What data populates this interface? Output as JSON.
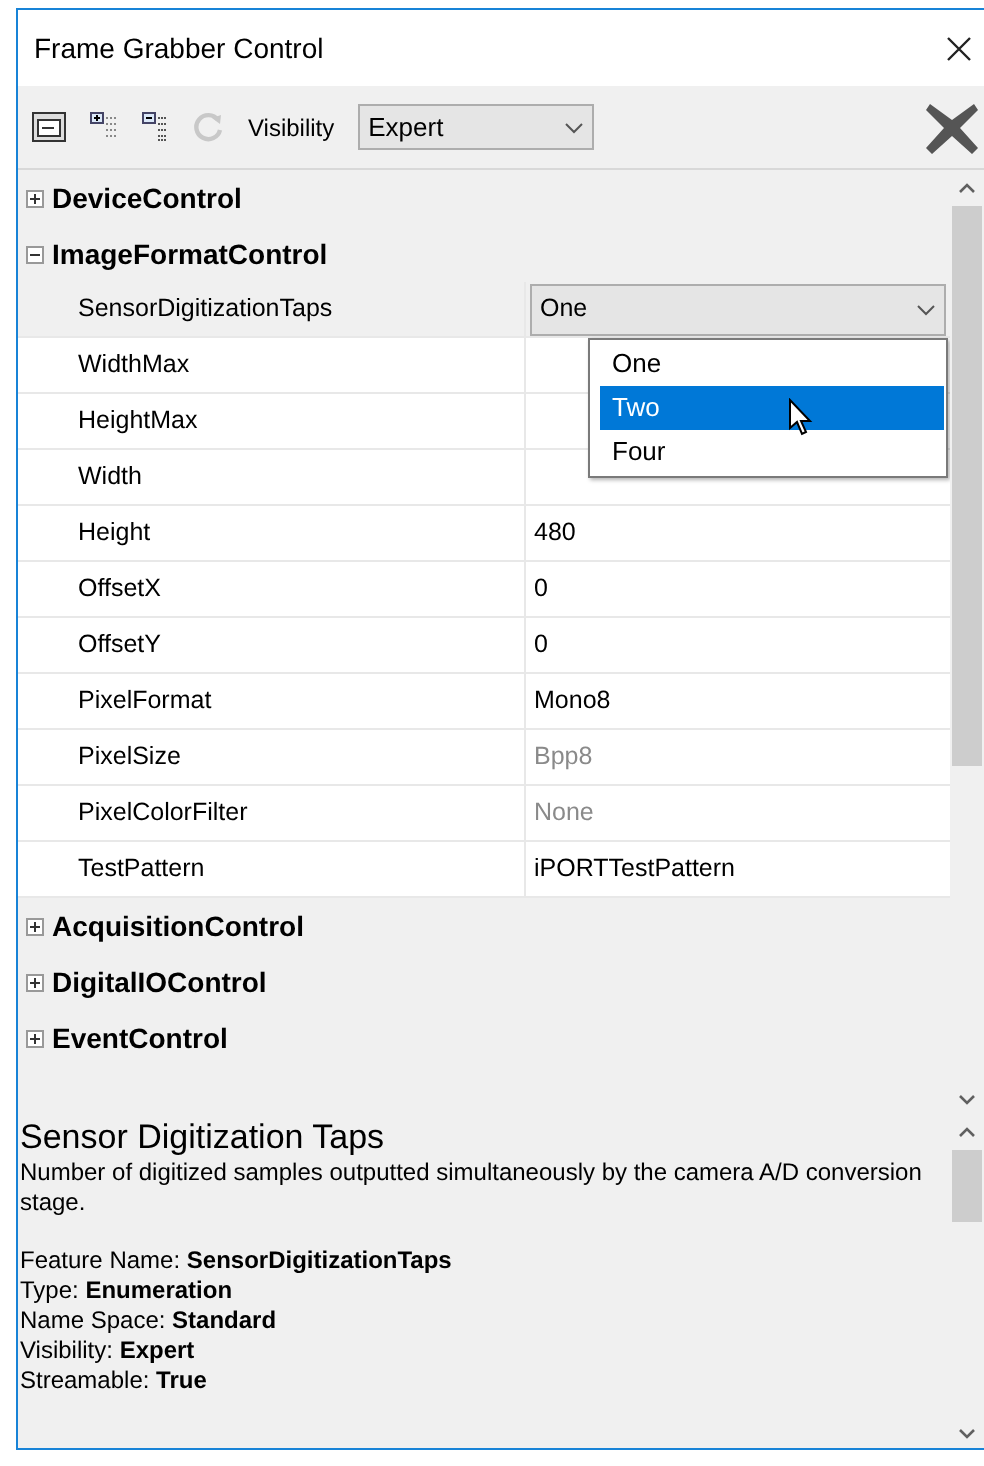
{
  "window": {
    "title": "Frame Grabber Control"
  },
  "toolbar": {
    "visibility_label": "Visibility",
    "visibility_value": "Expert"
  },
  "tree": [
    {
      "label": "DeviceControl",
      "expanded": false
    },
    {
      "label": "ImageFormatControl",
      "expanded": true,
      "children": [
        {
          "name": "SensorDigitizationTaps",
          "value": "One",
          "kind": "dropdown"
        },
        {
          "name": "WidthMax",
          "kind": "text"
        },
        {
          "name": "HeightMax",
          "kind": "text"
        },
        {
          "name": "Width",
          "kind": "text"
        },
        {
          "name": "Height",
          "value": "480",
          "kind": "text",
          "readonly": false
        },
        {
          "name": "OffsetX",
          "value": "0",
          "kind": "text",
          "readonly": false
        },
        {
          "name": "OffsetY",
          "value": "0",
          "kind": "text",
          "readonly": false
        },
        {
          "name": "PixelFormat",
          "value": "Mono8",
          "kind": "text",
          "readonly": false
        },
        {
          "name": "PixelSize",
          "value": "Bpp8",
          "kind": "text",
          "readonly": true
        },
        {
          "name": "PixelColorFilter",
          "value": "None",
          "kind": "text",
          "readonly": true
        },
        {
          "name": "TestPattern",
          "value": "iPORTTestPattern",
          "kind": "text",
          "readonly": false
        }
      ]
    },
    {
      "label": "AcquisitionControl",
      "expanded": false
    },
    {
      "label": "DigitalIOControl",
      "expanded": false
    },
    {
      "label": "EventControl",
      "expanded": false
    }
  ],
  "dropdown_options": [
    {
      "label": "One",
      "selected": false
    },
    {
      "label": "Two",
      "selected": true
    },
    {
      "label": "Four",
      "selected": false
    }
  ],
  "description": {
    "title": "Sensor Digitization Taps",
    "text": "Number of digitized samples outputted simultaneously by the camera A/D conversion stage.",
    "fields": [
      {
        "label": "Feature Name:",
        "value": "SensorDigitizationTaps"
      },
      {
        "label": "Type:",
        "value": "Enumeration"
      },
      {
        "label": "Name Space:",
        "value": "Standard"
      },
      {
        "label": "Visibility:",
        "value": "Expert"
      },
      {
        "label": "Streamable:",
        "value": "True"
      }
    ]
  }
}
